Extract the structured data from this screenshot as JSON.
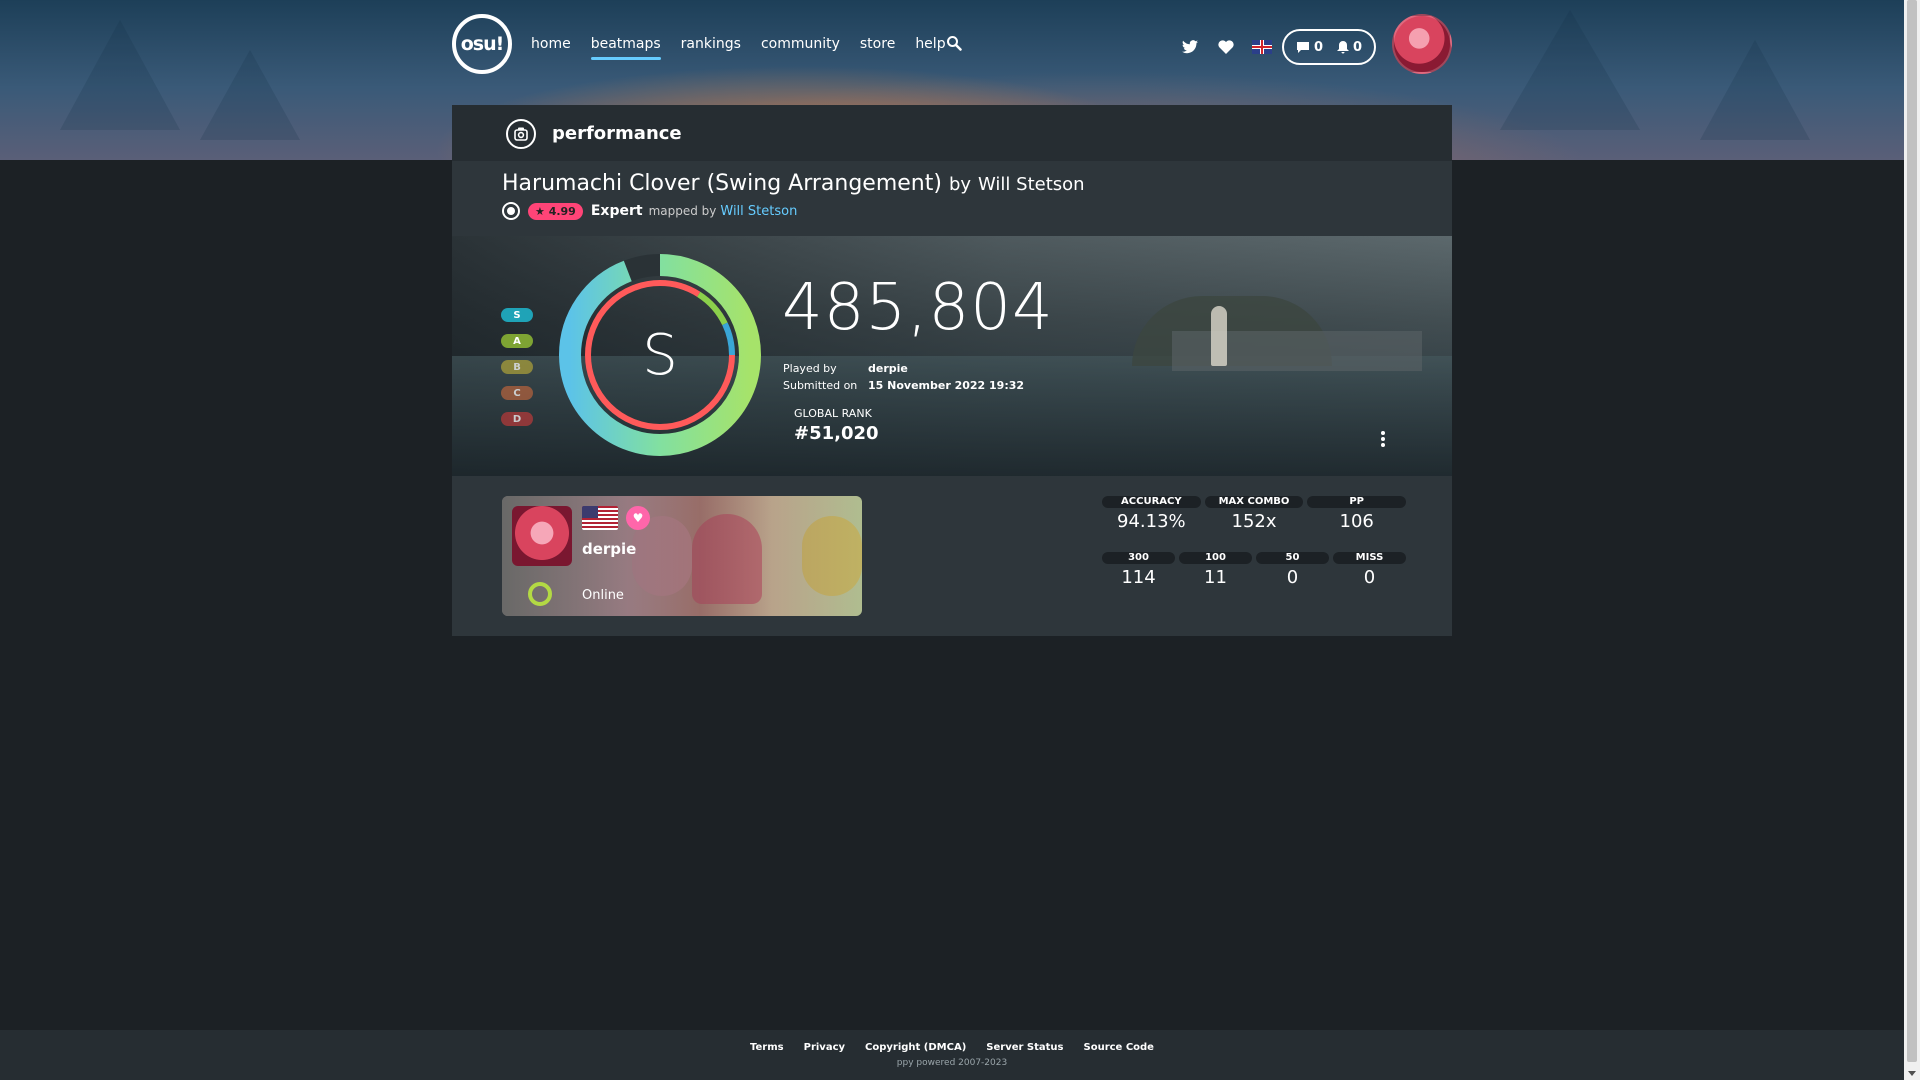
{
  "nav": {
    "logo": "osu!",
    "links": [
      "home",
      "beatmaps",
      "rankings",
      "community",
      "store",
      "help"
    ],
    "active": "beatmaps",
    "chat_count": "0",
    "notification_count": "0",
    "icons": [
      "search-icon",
      "twitter-icon",
      "heart-icon",
      "uk-flag-icon",
      "chat-icon",
      "bell-icon"
    ]
  },
  "header": {
    "title": "performance"
  },
  "beatmap": {
    "title": "Harumachi Clover (Swing Arrangement)",
    "by_label": "by",
    "artist": "Will Stetson",
    "star_rating": "★ 4.99",
    "difficulty": "Expert",
    "mapped_by_label": "mapped by",
    "mapper": "Will Stetson"
  },
  "score": {
    "grades": [
      "S",
      "A",
      "B",
      "C",
      "D"
    ],
    "rank": "S",
    "total": "485,804",
    "played_by_label": "Played by",
    "player": "derpie",
    "submitted_label": "Submitted on",
    "submitted": "15 November 2022 19:32",
    "global_rank_label": "GLOBAL RANK",
    "global_rank": "#51,020",
    "accuracy_fraction": 0.9413
  },
  "user": {
    "name": "derpie",
    "status": "Online"
  },
  "stats": {
    "accuracy_label": "ACCURACY",
    "accuracy": "94.13%",
    "max_combo_label": "MAX COMBO",
    "max_combo": "152x",
    "pp_label": "PP",
    "pp": "106",
    "c300_label": "300",
    "c300": "114",
    "c100_label": "100",
    "c100": "11",
    "c50_label": "50",
    "c50": "0",
    "miss_label": "MISS",
    "miss": "0"
  },
  "footer": {
    "links": [
      "Terms",
      "Privacy",
      "Copyright (DMCA)",
      "Server Status",
      "Source Code"
    ],
    "copyright": "ppy powered 2007-2023"
  },
  "colors": {
    "accent": "#66ccff",
    "background": "#1c2125",
    "panel": "#2e363b",
    "star_badge": "#ff4477",
    "online": "#b3d944"
  }
}
